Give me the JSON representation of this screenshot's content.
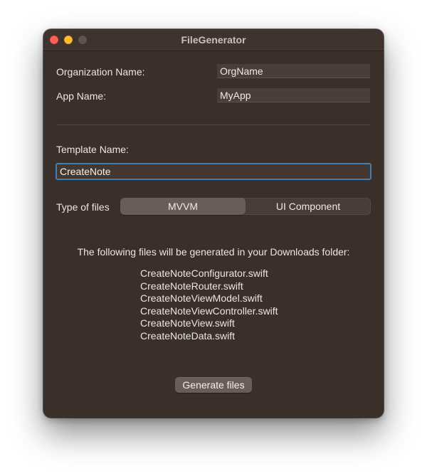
{
  "window": {
    "title": "FileGenerator"
  },
  "form": {
    "organization_label": "Organization Name:",
    "organization_value": "OrgName",
    "app_label": "App Name:",
    "app_value": "MyApp",
    "template_label": "Template Name:",
    "template_value": "CreateNote",
    "type_label": "Type of files",
    "type_options": [
      "MVVM",
      "UI Component"
    ],
    "type_selected": "MVVM"
  },
  "output": {
    "info_text": "The following files will be generated in your Downloads folder:",
    "files": [
      "CreateNoteConfigurator.swift",
      "CreateNoteRouter.swift",
      "CreateNoteViewModel.swift",
      "CreateNoteViewController.swift",
      "CreateNoteView.swift",
      "CreateNoteData.swift"
    ]
  },
  "actions": {
    "generate_label": "Generate files"
  },
  "colors": {
    "window_background": "#3b2f2a",
    "focus_ring": "#3e7fb8",
    "close_button": "#ff5f57",
    "minimize_button": "#febc2e"
  }
}
